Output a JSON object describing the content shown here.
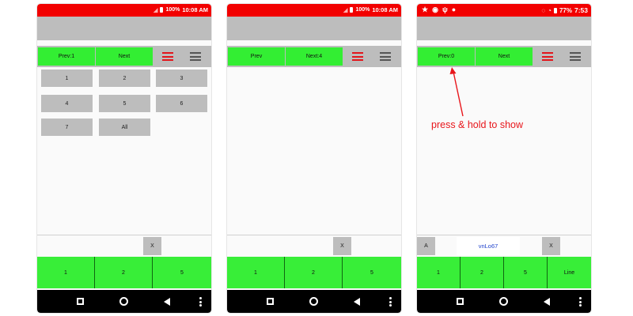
{
  "screens": [
    {
      "status": {
        "battery": "100%",
        "time": "10:08 AM"
      },
      "toolbar": {
        "prev_label": "Prev:1",
        "next_label": "Next"
      },
      "grid": [
        "1",
        "2",
        "3",
        "4",
        "5",
        "6",
        "7",
        "All"
      ],
      "input": {
        "x_label": "X"
      },
      "bottom": [
        "1",
        "2",
        "5"
      ]
    },
    {
      "status": {
        "battery": "100%",
        "time": "10:08 AM"
      },
      "toolbar": {
        "prev_label": "Prev",
        "next_label": "Next:4"
      },
      "input": {
        "x_label": "X"
      },
      "bottom": [
        "1",
        "2",
        "5"
      ]
    },
    {
      "status": {
        "battery": "77%",
        "time": "7:53"
      },
      "toolbar": {
        "prev_label": "Prev:0",
        "next_label": "Next"
      },
      "annotation": "press & hold to show",
      "input": {
        "a_label": "A",
        "code": "vnLo67",
        "x_label": "X"
      },
      "bottom": [
        "1",
        "2",
        "5",
        "Line"
      ]
    }
  ],
  "colors": {
    "status_red": "#f20000",
    "accent_green": "#33ee33",
    "hamburger_red": "#e3151b",
    "code_blue": "#2244cc"
  }
}
